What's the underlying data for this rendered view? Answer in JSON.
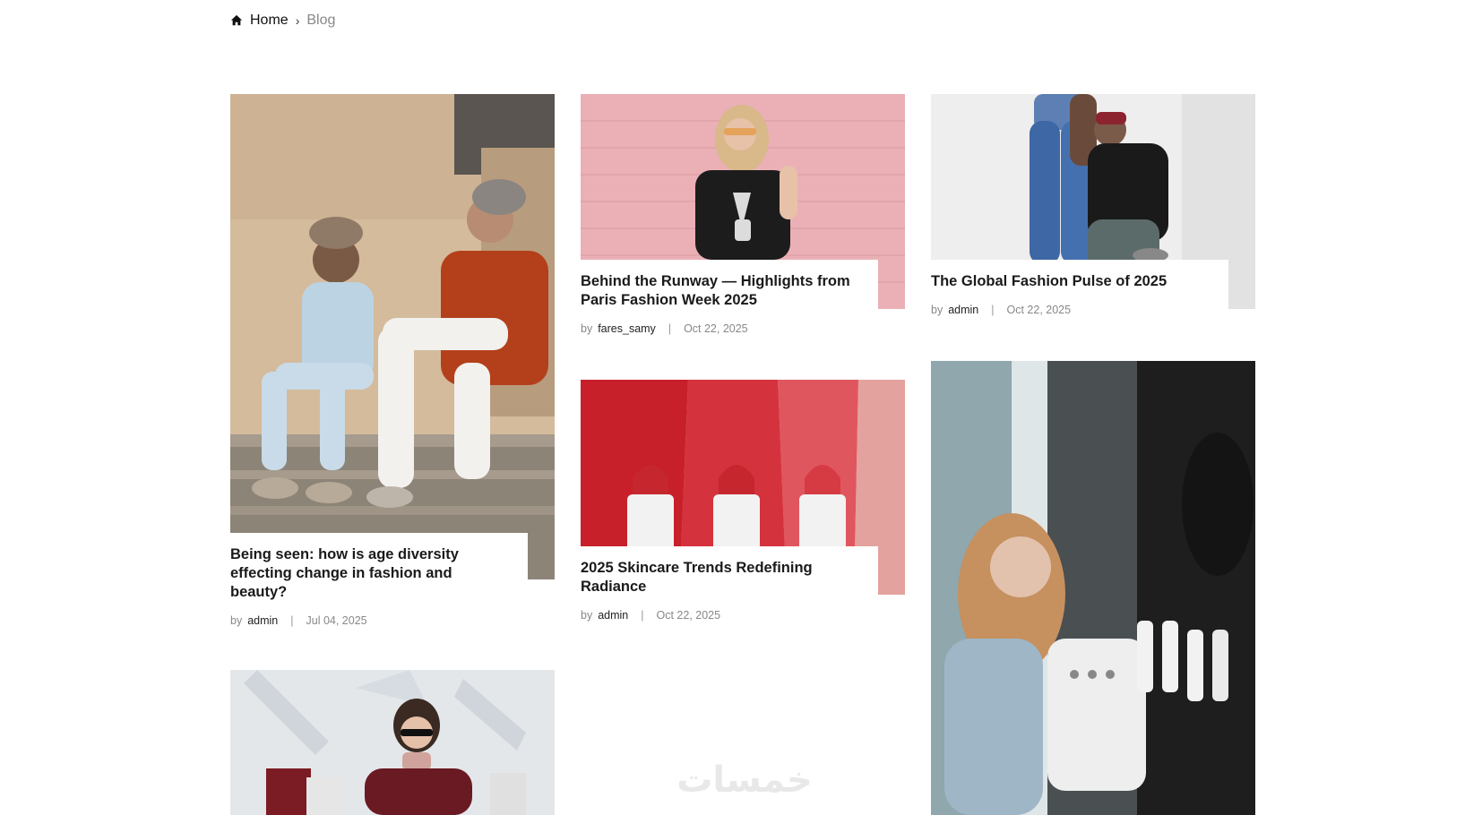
{
  "breadcrumb": {
    "home_icon": "home-icon",
    "home": "Home",
    "separator": "›",
    "current": "Blog"
  },
  "posts": [
    {
      "title": "Being seen: how is age diversity effecting change in fashion and beauty?",
      "by": "by",
      "author": "admin",
      "separator": "|",
      "date": "Jul 04, 2025"
    },
    {
      "title": "Behind the Runway — Highlights from Paris Fashion Week 2025",
      "by": "by",
      "author": "fares_samy",
      "separator": "|",
      "date": "Oct 22, 2025"
    },
    {
      "title": "The Global Fashion Pulse of 2025",
      "by": "by",
      "author": "admin",
      "separator": "|",
      "date": "Oct 22, 2025"
    },
    {
      "title": "2025 Skincare Trends Redefining Radiance",
      "by": "by",
      "author": "admin",
      "separator": "|",
      "date": "Oct 22, 2025"
    },
    {
      "title": ""
    },
    {
      "title": ""
    }
  ],
  "watermark": "خمسات",
  "colors": {
    "pink_wall": "#eab0b6",
    "lipstick_red": "#c7202b",
    "steps_beige": "#d9c3a8",
    "meta_gray": "#888888"
  }
}
